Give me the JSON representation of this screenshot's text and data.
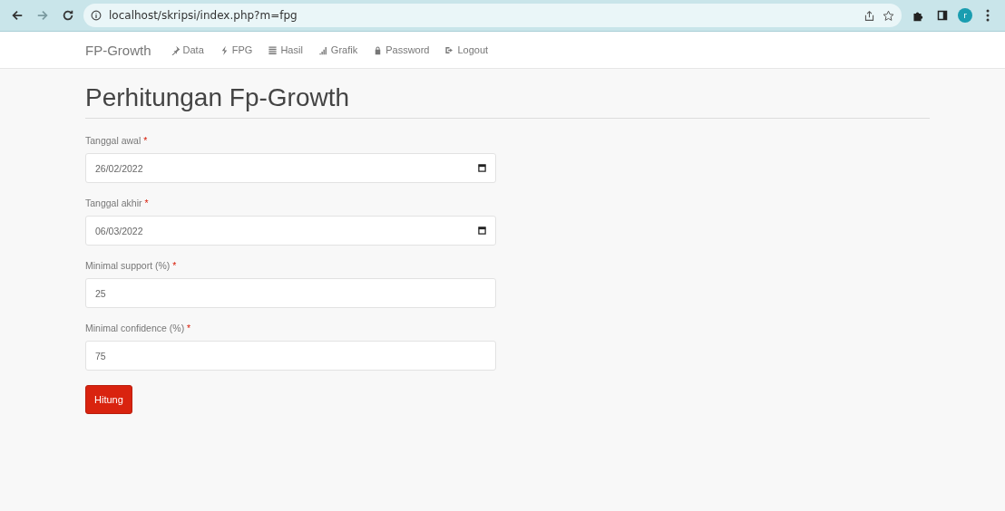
{
  "browser": {
    "url": "localhost/skripsi/index.php?m=fpg",
    "avatar_letter": "r"
  },
  "navbar": {
    "brand": "FP-Growth",
    "items": [
      {
        "label": "Data"
      },
      {
        "label": "FPG"
      },
      {
        "label": "Hasil"
      },
      {
        "label": "Grafik"
      },
      {
        "label": "Password"
      },
      {
        "label": "Logout"
      }
    ]
  },
  "page": {
    "title": "Perhitungan Fp-Growth",
    "fields": [
      {
        "kind": "date",
        "label": "Tanggal awal",
        "required_mark": "*",
        "value": "26/02/2022"
      },
      {
        "kind": "date",
        "label": "Tanggal akhir",
        "required_mark": "*",
        "value": "06/03/2022"
      },
      {
        "kind": "number",
        "label": "Minimal support (%)",
        "required_mark": "*",
        "value": "25"
      },
      {
        "kind": "number",
        "label": "Minimal confidence (%)",
        "required_mark": "*",
        "value": "75"
      }
    ],
    "submit": "Hitung"
  }
}
